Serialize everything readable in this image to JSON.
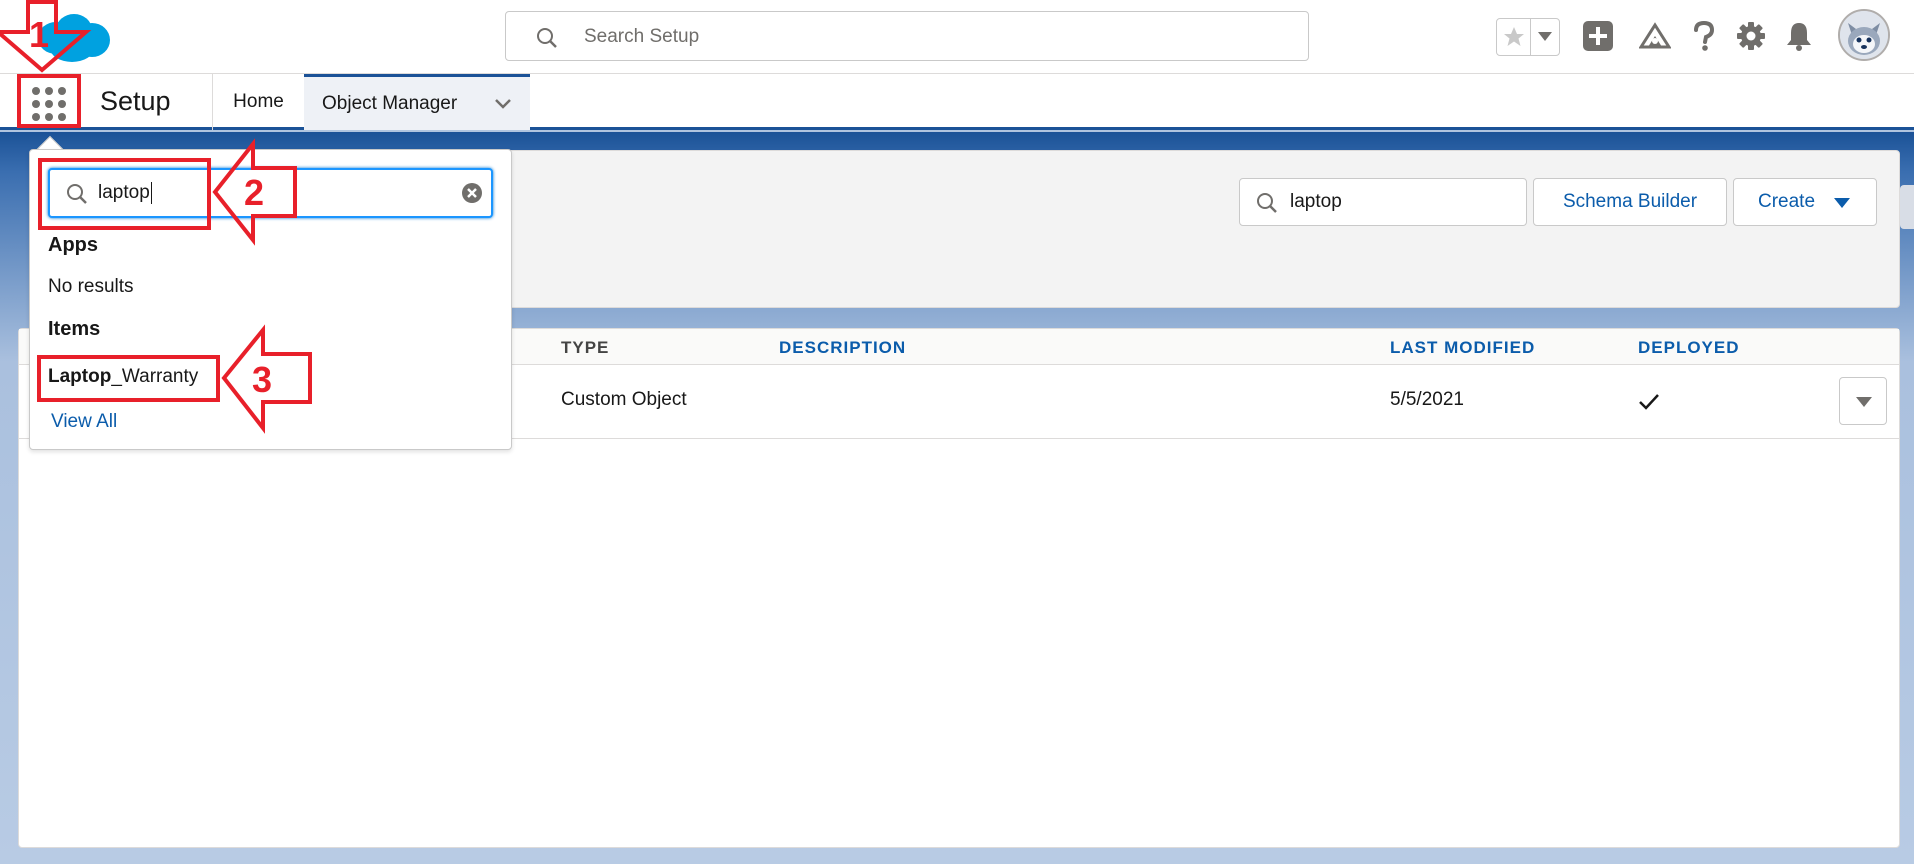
{
  "header": {
    "search_placeholder": "Search Setup"
  },
  "context_bar": {
    "app_name": "Setup",
    "tabs": [
      {
        "label": "Home"
      },
      {
        "label": "Object Manager"
      }
    ]
  },
  "object_manager": {
    "quick_find_value": "laptop",
    "schema_builder_label": "Schema Builder",
    "create_label": "Create",
    "columns": [
      "TYPE",
      "DESCRIPTION",
      "LAST MODIFIED",
      "DEPLOYED"
    ],
    "rows": [
      {
        "type": "Custom Object",
        "description": "",
        "last_modified": "5/5/2021",
        "deployed": true
      }
    ]
  },
  "app_launcher": {
    "search_value": "laptop",
    "apps_heading": "Apps",
    "apps_empty": "No results",
    "items_heading": "Items",
    "item_match": "Laptop",
    "item_rest": "_Warranty",
    "view_all": "View All"
  },
  "annotations": {
    "steps": [
      "1",
      "2",
      "3"
    ],
    "color": "#e8202a"
  },
  "colors": {
    "brand_blue": "#0b5cab",
    "nav_active": "#1b5297",
    "salesforce_cloud": "#00a1e0"
  },
  "icons": [
    "salesforce-logo",
    "search-icon",
    "star-icon",
    "chevron-down-icon",
    "add-icon",
    "trailhead-icon",
    "help-icon",
    "gear-icon",
    "bell-icon",
    "avatar",
    "app-launcher-icon",
    "clear-icon",
    "checkmark-icon"
  ]
}
